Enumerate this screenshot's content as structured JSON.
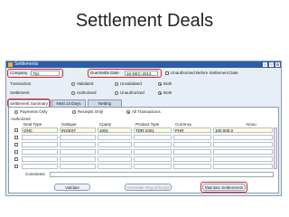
{
  "slide_title": "Settlement Deals",
  "window": {
    "title": "Settlements"
  },
  "header": {
    "company_label": "Company",
    "company_value": "751",
    "due_date_label": "Due/Settle Date",
    "due_date_value": "16-DEC-2013",
    "unauth_before_label": "Unauthorised Before Settlement Date"
  },
  "transaction_row": {
    "label": "Transaction",
    "opt1": "Validated",
    "opt2": "Unvalidated",
    "opt3": "Both"
  },
  "settlement_row": {
    "label": "Settlement",
    "opt1": "Authorised",
    "opt2": "Unauthorized",
    "opt3": "Both"
  },
  "tabs": [
    "Settlement Summary",
    "Next 14 Days",
    "Netting"
  ],
  "filter": {
    "opt1": "Payments Only",
    "opt2": "Receipts Only",
    "opt3": "All Transactions"
  },
  "grid": {
    "authorized_label": "Authorized",
    "columns": [
      "Deal Type",
      "Subtype",
      "Cparty",
      "Product Type",
      "Currency",
      "Amou"
    ],
    "rows": [
      [
        "ONC",
        "INVEST",
        "1001",
        "TDR-1001",
        "PHR",
        "100,000.0"
      ],
      [
        "",
        "",
        "",
        "",
        "",
        ""
      ],
      [
        "",
        "",
        "",
        "",
        "",
        ""
      ],
      [
        "",
        "",
        "",
        "",
        "",
        ""
      ],
      [
        "",
        "",
        "",
        "",
        "",
        ""
      ],
      [
        "",
        "",
        "",
        "",
        "",
        ""
      ]
    ]
  },
  "comments_label": "Comments",
  "buttons": {
    "validate": "Validate",
    "generate": "Generate Report/Script",
    "maintain": "Maintain Settlements"
  }
}
